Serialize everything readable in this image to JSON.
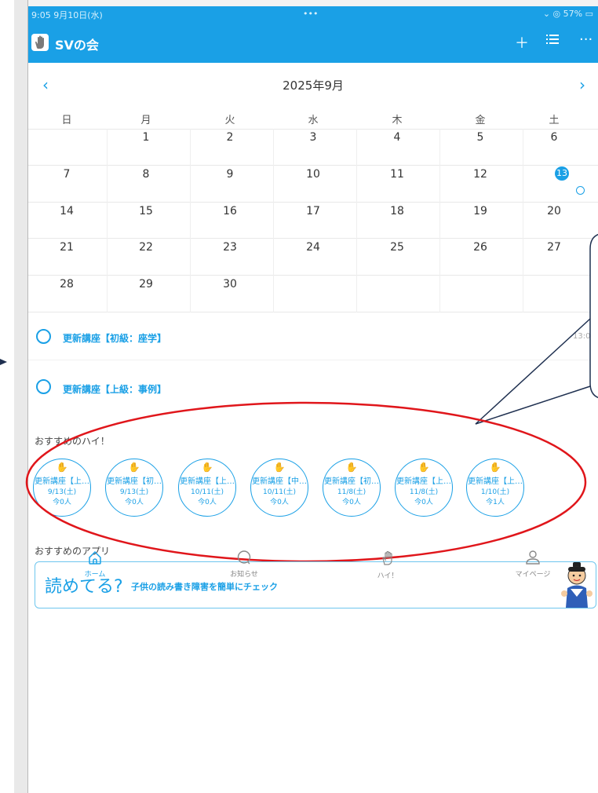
{
  "status_bar": {
    "left": "9:05  9月10日(水)",
    "center": "•••",
    "right": "⌄ ◎ 57% ▭"
  },
  "header": {
    "title": "SVの会",
    "add_icon": "plus-icon",
    "list_icon": "list-icon",
    "more_icon": "more-icon"
  },
  "calendar": {
    "month_title": "2025年9月",
    "weekdays": [
      "日",
      "月",
      "火",
      "水",
      "木",
      "金",
      "土"
    ],
    "weeks": [
      [
        "",
        "1",
        "2",
        "3",
        "4",
        "5",
        "6"
      ],
      [
        "7",
        "8",
        "9",
        "10",
        "11",
        "12",
        "13"
      ],
      [
        "14",
        "15",
        "16",
        "17",
        "18",
        "19",
        "20"
      ],
      [
        "21",
        "22",
        "23",
        "24",
        "25",
        "26",
        "27"
      ],
      [
        "28",
        "29",
        "30",
        "",
        "",
        "",
        ""
      ]
    ],
    "today": "13"
  },
  "events": [
    {
      "title": "更新講座【初級：座学】",
      "time": "13:0"
    },
    {
      "title": "更新講座【上級：事例】",
      "time": ""
    }
  ],
  "recommended_hi": {
    "title": "おすすめのハイ！",
    "items": [
      {
        "title": "更新講座【上…",
        "date": "9/13(土)",
        "count": "今0人"
      },
      {
        "title": "更新講座【初…",
        "date": "9/13(土)",
        "count": "今0人"
      },
      {
        "title": "更新講座【上…",
        "date": "10/11(土)",
        "count": "今0人"
      },
      {
        "title": "更新講座【中…",
        "date": "10/11(土)",
        "count": "今0人"
      },
      {
        "title": "更新講座【初…",
        "date": "11/8(土)",
        "count": "今0人"
      },
      {
        "title": "更新講座【上…",
        "date": "11/8(土)",
        "count": "今0人"
      },
      {
        "title": "更新講座【上…",
        "date": "1/10(土)",
        "count": "今1人"
      }
    ]
  },
  "recommended_app": {
    "title": "おすすめのアプリ",
    "logo": "読めてる?",
    "text": "子供の読み書き障害を簡単にチェック"
  },
  "tabs": [
    {
      "label": "ホーム",
      "icon": "home-icon",
      "active": true
    },
    {
      "label": "お知らせ",
      "icon": "chat-icon",
      "active": false
    },
    {
      "label": "ハイ！",
      "icon": "hand-icon",
      "active": false
    },
    {
      "label": "マイページ",
      "icon": "person-icon",
      "active": false
    }
  ],
  "colors": {
    "accent": "#1aa0e6",
    "annotation_red": "#e0161b",
    "callout_outline": "#1f3050"
  }
}
